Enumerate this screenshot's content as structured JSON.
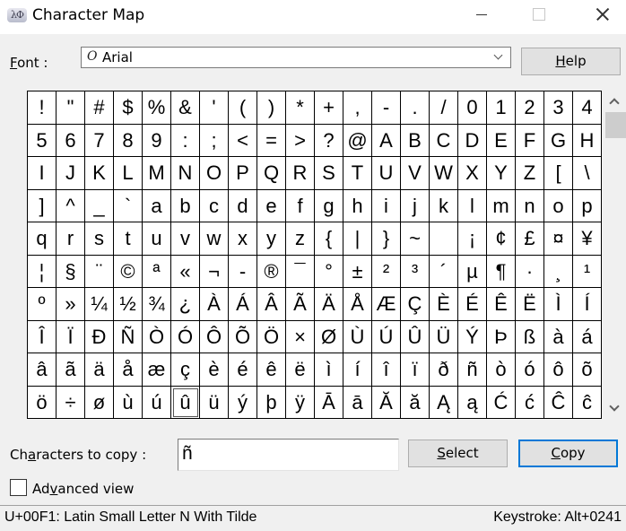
{
  "window": {
    "title": "Character Map",
    "app_icon": "character-map-icon",
    "controls": [
      "minimize",
      "maximize",
      "close"
    ]
  },
  "font": {
    "label_accel": "F",
    "label_rest": "ont :",
    "value": "Arial",
    "value_icon": "opentype-font-icon",
    "value_glyph": "O"
  },
  "buttons": {
    "help_accel": "H",
    "help_rest": "elp",
    "select_accel": "S",
    "select_rest": "elect",
    "copy_accel": "C",
    "copy_rest": "opy"
  },
  "grid": {
    "columns": 20,
    "selected_index": 185,
    "rows": [
      [
        "!",
        "\"",
        "#",
        "$",
        "%",
        "&",
        "'",
        "(",
        ")",
        "*",
        "+",
        ",",
        "-",
        ".",
        "/",
        "0",
        "1",
        "2",
        "3",
        "4"
      ],
      [
        "5",
        "6",
        "7",
        "8",
        "9",
        ":",
        ";",
        "<",
        "=",
        ">",
        "?",
        "@",
        "A",
        "B",
        "C",
        "D",
        "E",
        "F",
        "G",
        "H"
      ],
      [
        "I",
        "J",
        "K",
        "L",
        "M",
        "N",
        "O",
        "P",
        "Q",
        "R",
        "S",
        "T",
        "U",
        "V",
        "W",
        "X",
        "Y",
        "Z",
        "[",
        "\\"
      ],
      [
        "]",
        "^",
        "_",
        "`",
        "a",
        "b",
        "c",
        "d",
        "e",
        "f",
        "g",
        "h",
        "i",
        "j",
        "k",
        "l",
        "m",
        "n",
        "o",
        "p"
      ],
      [
        "q",
        "r",
        "s",
        "t",
        "u",
        "v",
        "w",
        "x",
        "y",
        "z",
        "{",
        "|",
        "}",
        "~",
        " ",
        "¡",
        "¢",
        "£",
        "¤",
        "¥"
      ],
      [
        "¦",
        "§",
        "¨",
        "©",
        "ª",
        "«",
        "¬",
        "-",
        "®",
        "¯",
        "°",
        "±",
        "²",
        "³",
        "´",
        "µ",
        "¶",
        "·",
        "¸",
        "¹"
      ],
      [
        "º",
        "»",
        "¼",
        "½",
        "¾",
        "¿",
        "À",
        "Á",
        "Â",
        "Ã",
        "Ä",
        "Å",
        "Æ",
        "Ç",
        "È",
        "É",
        "Ê",
        "Ë",
        "Ì",
        "Í"
      ],
      [
        "Î",
        "Ï",
        "Ð",
        "Ñ",
        "Ò",
        "Ó",
        "Ô",
        "Õ",
        "Ö",
        "×",
        "Ø",
        "Ù",
        "Ú",
        "Û",
        "Ü",
        "Ý",
        "Þ",
        "ß",
        "à",
        "á"
      ],
      [
        "â",
        "ã",
        "ä",
        "å",
        "æ",
        "ç",
        "è",
        "é",
        "ê",
        "ë",
        "ì",
        "í",
        "î",
        "ï",
        "ð",
        "ñ",
        "ò",
        "ó",
        "ô",
        "õ"
      ],
      [
        "ö",
        "÷",
        "ø",
        "ù",
        "ú",
        "û",
        "ü",
        "ý",
        "þ",
        "ÿ",
        "Ā",
        "ā",
        "Ă",
        "ă",
        "Ą",
        "ą",
        "Ć",
        "ć",
        "Ĉ",
        "ĉ"
      ]
    ]
  },
  "copy": {
    "label_pre": "Ch",
    "label_accel": "a",
    "label_post": "racters to copy :",
    "value": "ñ"
  },
  "advanced": {
    "label_pre": "Ad",
    "label_accel": "v",
    "label_post": "anced view",
    "checked": false
  },
  "status": {
    "description": "U+00F1: Latin Small Letter N With Tilde",
    "keystroke": "Keystroke: Alt+0241"
  },
  "colors": {
    "focus_border": "#0078d7",
    "background": "#f0f0f0",
    "button_face": "#e1e1e1"
  }
}
